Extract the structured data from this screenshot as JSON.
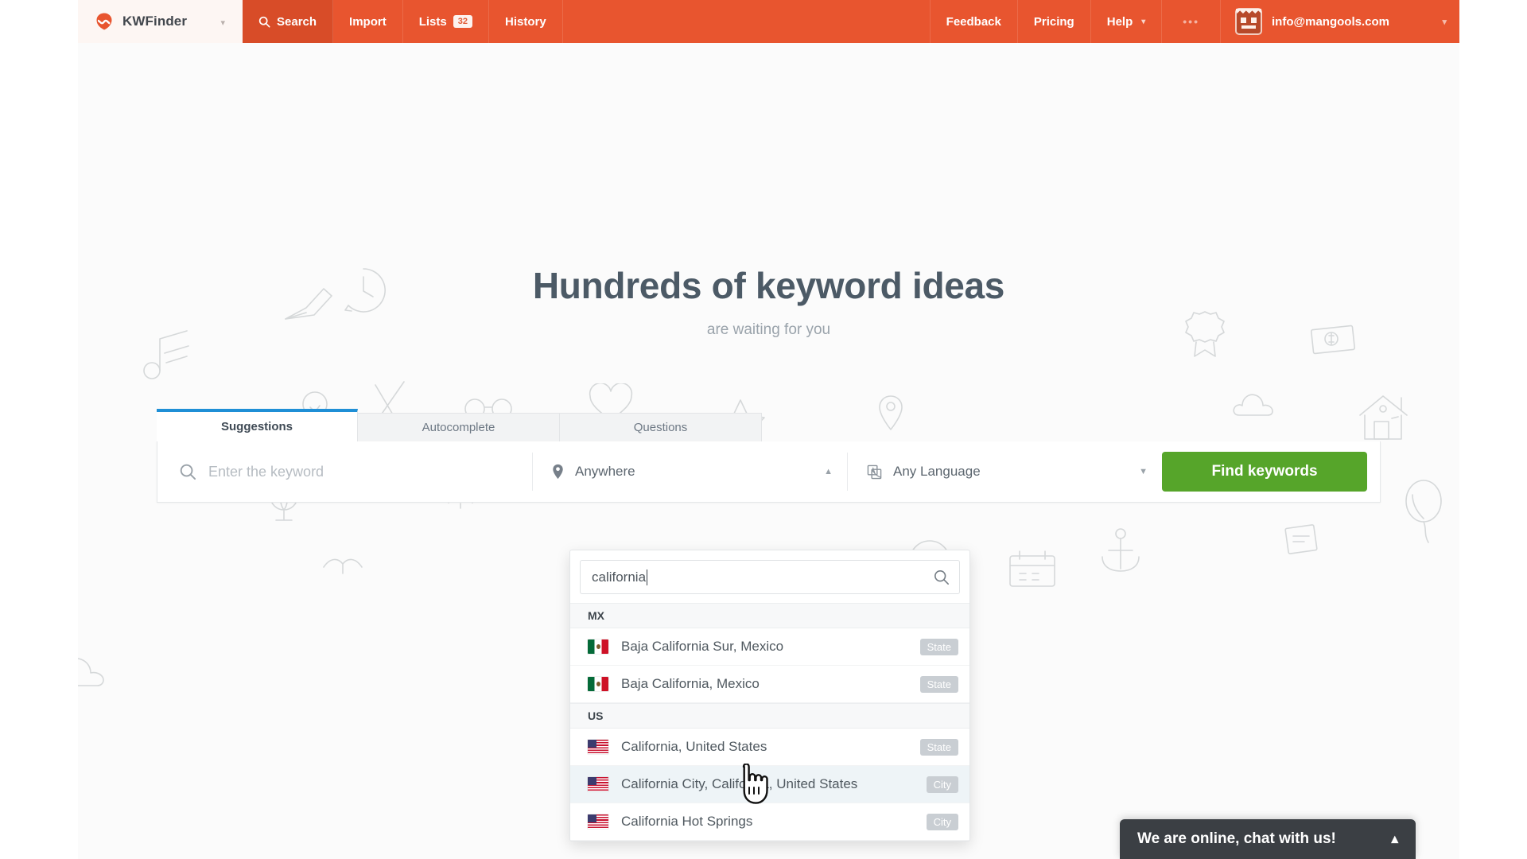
{
  "brand": {
    "name": "KWFinder",
    "logo_icon": "mangools-logo-icon",
    "caret_icon": "chevron-down-icon"
  },
  "topnav": {
    "items": [
      {
        "label": "Search",
        "icon": "search-icon",
        "active": true
      },
      {
        "label": "Import",
        "active": false
      },
      {
        "label": "Lists",
        "badge": "32",
        "active": false
      },
      {
        "label": "History",
        "active": false
      }
    ],
    "right_items": [
      {
        "label": "Feedback"
      },
      {
        "label": "Pricing"
      },
      {
        "label": "Help",
        "caret_icon": "chevron-down-icon"
      },
      {
        "label": "•••",
        "name": "more-menu"
      }
    ],
    "user": {
      "email": "info@mangools.com",
      "avatar_icon": "user-avatar-icon",
      "caret_icon": "chevron-down-icon"
    }
  },
  "hero": {
    "title": "Hundreds of keyword ideas",
    "subtitle": "are waiting for you"
  },
  "tabs": [
    {
      "label": "Suggestions",
      "active": true
    },
    {
      "label": "Autocomplete",
      "active": false
    },
    {
      "label": "Questions",
      "active": false
    }
  ],
  "search": {
    "keyword_placeholder": "Enter the keyword",
    "keyword_icon": "search-icon",
    "location": {
      "value": "Anywhere",
      "icon": "map-pin-icon",
      "caret_icon": "chevron-up-icon"
    },
    "language": {
      "value": "Any Language",
      "icon": "language-icon",
      "caret_icon": "chevron-down-icon"
    },
    "submit_label": "Find keywords",
    "submit_color": "#56a52a"
  },
  "location_dropdown": {
    "query": "california",
    "search_icon": "search-icon",
    "groups": [
      {
        "header": "MX",
        "items": [
          {
            "name": "Baja California Sur, Mexico",
            "tag": "State",
            "flag": "mx",
            "hover": false
          },
          {
            "name": "Baja California, Mexico",
            "tag": "State",
            "flag": "mx",
            "hover": false
          }
        ]
      },
      {
        "header": "US",
        "items": [
          {
            "name": "California, United States",
            "tag": "State",
            "flag": "us",
            "hover": false
          },
          {
            "name": "California City, California, United States",
            "tag": "City",
            "flag": "us",
            "hover": true
          },
          {
            "name": "California Hot Springs",
            "tag": "City",
            "flag": "us",
            "hover": false
          }
        ]
      }
    ]
  },
  "chat_widget": {
    "text": "We are online, chat with us!",
    "toggle_icon": "chevron-up-icon"
  },
  "colors": {
    "header": "#e8552f",
    "accent_tab": "#1f8fd6",
    "cta": "#56a52a",
    "chat_bg": "#3b3f44"
  }
}
